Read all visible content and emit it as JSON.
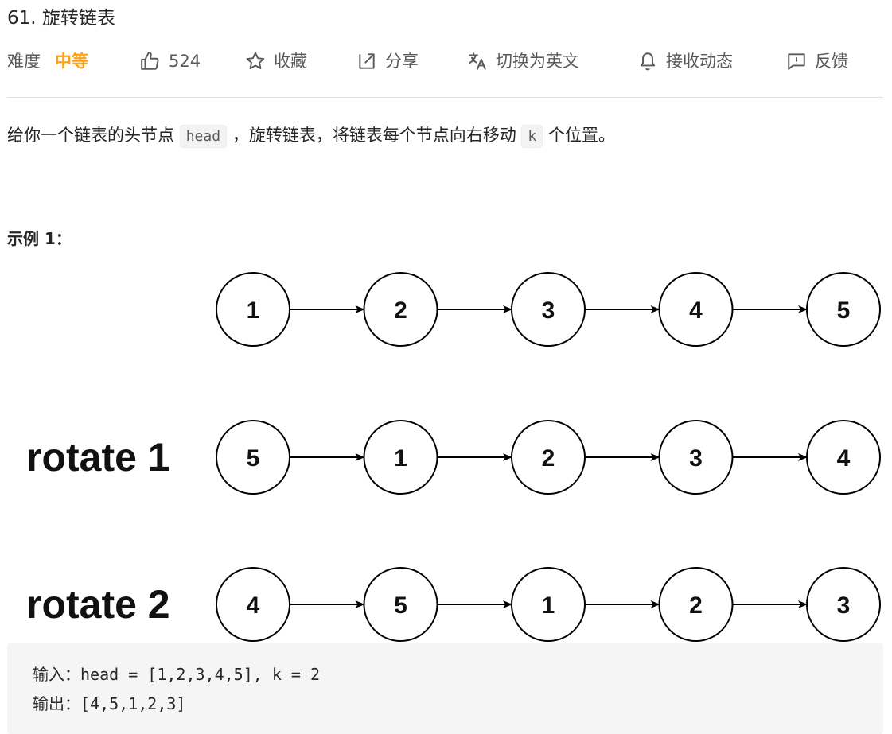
{
  "problem": {
    "title": "61. 旋转链表",
    "difficulty_label": "难度",
    "difficulty_value": "中等",
    "like_count": "524",
    "favorite_label": "收藏",
    "share_label": "分享",
    "translate_label": "切换为英文",
    "subscribe_label": "接收动态",
    "feedback_label": "反馈"
  },
  "description": {
    "part1": "给你一个链表的头节点",
    "code_head": "head",
    "part2": "，旋转链表，将链表每个节点向右移动",
    "code_k": "k",
    "part3": "个位置。"
  },
  "example": {
    "title": "示例 1：",
    "input_line": "输入：head = [1,2,3,4,5], k = 2",
    "output_line": "输出：[4,5,1,2,3]"
  },
  "diagram": {
    "rows": [
      {
        "label": "",
        "nodes": [
          "1",
          "2",
          "3",
          "4",
          "5"
        ]
      },
      {
        "label": "rotate 1",
        "nodes": [
          "5",
          "1",
          "2",
          "3",
          "4"
        ]
      },
      {
        "label": "rotate 2",
        "nodes": [
          "4",
          "5",
          "1",
          "2",
          "3"
        ]
      }
    ]
  },
  "colors": {
    "accent_medium": "#ffa116",
    "text": "#262626",
    "muted": "#595959",
    "code_bg": "#f5f5f5"
  },
  "icons": [
    "thumbs-up-icon",
    "star-icon",
    "share-icon",
    "translate-icon",
    "bell-icon",
    "feedback-icon"
  ]
}
